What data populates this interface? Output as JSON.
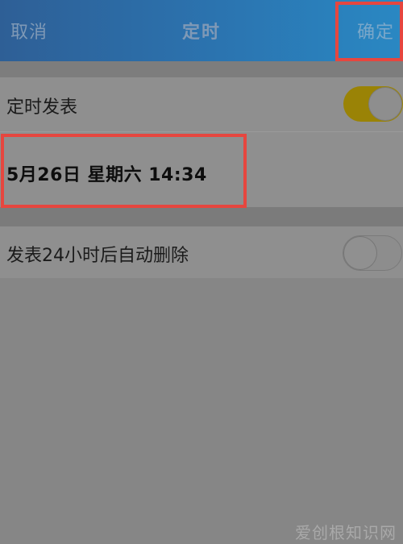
{
  "header": {
    "cancel_label": "取消",
    "title": "定时",
    "confirm_label": "确定"
  },
  "settings": {
    "scheduled_post": {
      "label": "定时发表",
      "enabled": true
    },
    "scheduled_time": "5月26日 星期六 14:34",
    "auto_delete": {
      "label": "发表24小时后自动删除",
      "enabled": false
    }
  },
  "watermark": "爱创根知识网",
  "colors": {
    "header": "#2b74b0",
    "toggle_on": "#9a8306",
    "highlight": "#e6463f"
  }
}
